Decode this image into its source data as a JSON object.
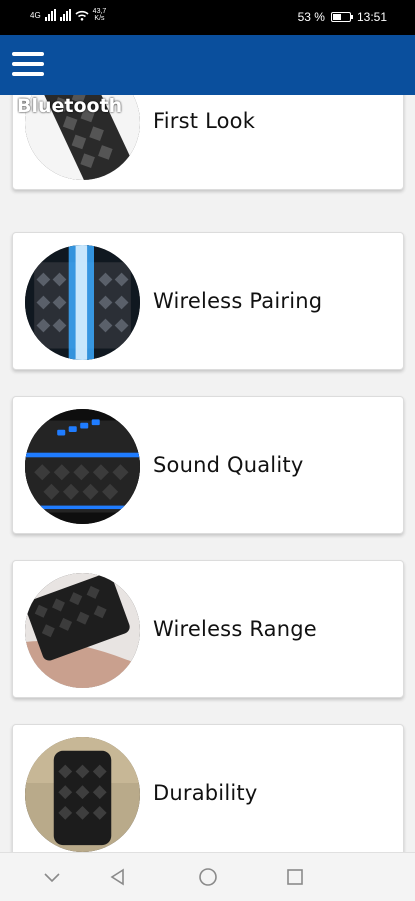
{
  "status_bar": {
    "carrier_left": "4G",
    "network_speed": "43,7",
    "network_speed_unit": "K/s",
    "battery_text": "53 %",
    "battery_level": 0.53,
    "time": "13:51"
  },
  "app_bar": {
    "color": "#0a4f9d",
    "menu_icon": "hamburger-menu-icon"
  },
  "items": [
    {
      "label": "First Look",
      "image_overlay": "Guide for Bluetooth",
      "image": "speaker-closeup"
    },
    {
      "label": "Wireless Pairing",
      "image": "speaker-blue-light"
    },
    {
      "label": "Sound Quality",
      "image": "speaker-blue-buttons"
    },
    {
      "label": "Wireless Range",
      "image": "speaker-in-hand"
    },
    {
      "label": "Durability",
      "image": "speaker-upright"
    }
  ],
  "nav_bar": {
    "icons": [
      "chevron-down-icon",
      "back-icon",
      "home-icon",
      "recents-icon"
    ]
  }
}
